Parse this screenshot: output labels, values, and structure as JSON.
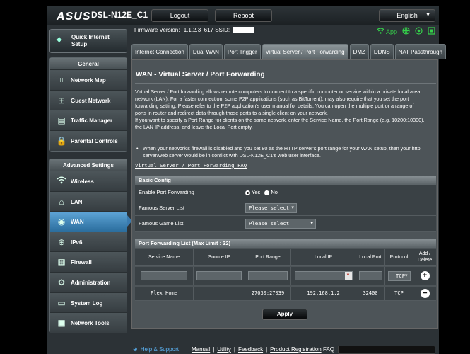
{
  "header": {
    "brand": "ASUS",
    "model": "DSL-N12E_C1",
    "logout_label": "Logout",
    "reboot_label": "Reboot",
    "language": "English"
  },
  "infobar": {
    "firmware_label": "Firmware Version:",
    "firmware_value": "1.1.2.3_617",
    "ssid_label": "SSID:",
    "app_label": "App"
  },
  "sidebar": {
    "qis_label": "Quick Internet Setup",
    "general_header": "General",
    "general_items": [
      {
        "label": "Network Map",
        "icon": "network-map-icon"
      },
      {
        "label": "Guest Network",
        "icon": "guest-network-icon"
      },
      {
        "label": "Traffic Manager",
        "icon": "traffic-manager-icon"
      },
      {
        "label": "Parental Controls",
        "icon": "parental-controls-icon"
      }
    ],
    "advanced_header": "Advanced Settings",
    "advanced_items": [
      {
        "label": "Wireless",
        "icon": "wireless-icon"
      },
      {
        "label": "LAN",
        "icon": "lan-icon"
      },
      {
        "label": "WAN",
        "icon": "wan-icon"
      },
      {
        "label": "IPv6",
        "icon": "ipv6-icon"
      },
      {
        "label": "Firewall",
        "icon": "firewall-icon"
      },
      {
        "label": "Administration",
        "icon": "administration-icon"
      },
      {
        "label": "System Log",
        "icon": "system-log-icon"
      },
      {
        "label": "Network Tools",
        "icon": "network-tools-icon"
      }
    ]
  },
  "tabs": [
    "Internet Connection",
    "Dual WAN",
    "Port Trigger",
    "Virtual Server / Port Forwarding",
    "DMZ",
    "DDNS",
    "NAT Passthrough"
  ],
  "page": {
    "title": "WAN - Virtual Server / Port Forwarding",
    "desc_lines": [
      "Virtual Server / Port forwarding allows remote computers to connect to a specific computer or service within a private local area",
      "network (LAN). For a faster connection, some P2P applications (such as BitTorrent), may also require that you set the port",
      "forwarding setting. Please refer to the P2P application's user manual for details. You can open the multiple port or a range of",
      "ports in router and redirect data through those ports to a single client on your network.",
      "If you want to specify a Port Range for clients on the same network, enter the Service Name, the Port Range (e.g. 10200:10300),",
      "the LAN IP address, and leave the Local Port empty."
    ],
    "bullet_lines": [
      "When your network's firewall is disabled and you set 80 as the HTTP server's port range for your WAN setup, then your http",
      "server/web server would be in conflict with DSL-N12E_C1's web user interface."
    ],
    "faq_link": "Virtual Server / Port Forwarding FAQ"
  },
  "basic_config": {
    "header": "Basic Config",
    "enable_label": "Enable Port Forwarding",
    "yes_label": "Yes",
    "no_label": "No",
    "server_label": "Famous Server List",
    "server_select": "Please select",
    "game_label": "Famous Game List",
    "game_select": "Please select"
  },
  "pf_list": {
    "header": "Port Forwarding List (Max Limit : 32)",
    "columns": [
      "Service Name",
      "Source IP",
      "Port Range",
      "Local IP",
      "Local Port",
      "Protocol",
      "Add / Delete"
    ],
    "protocol_default": "TCP",
    "rows": [
      {
        "service": "Plex Home",
        "source_ip": "",
        "port_range": "27030:27039",
        "local_ip": "192.168.1.2",
        "local_port": "32400",
        "protocol": "TCP"
      }
    ]
  },
  "apply_label": "Apply",
  "footer": {
    "help_label": "Help & Support",
    "manual": "Manual",
    "utility": "Utility",
    "feedback": "Feedback",
    "registration": "Product Registration",
    "faq_label": "FAQ"
  }
}
